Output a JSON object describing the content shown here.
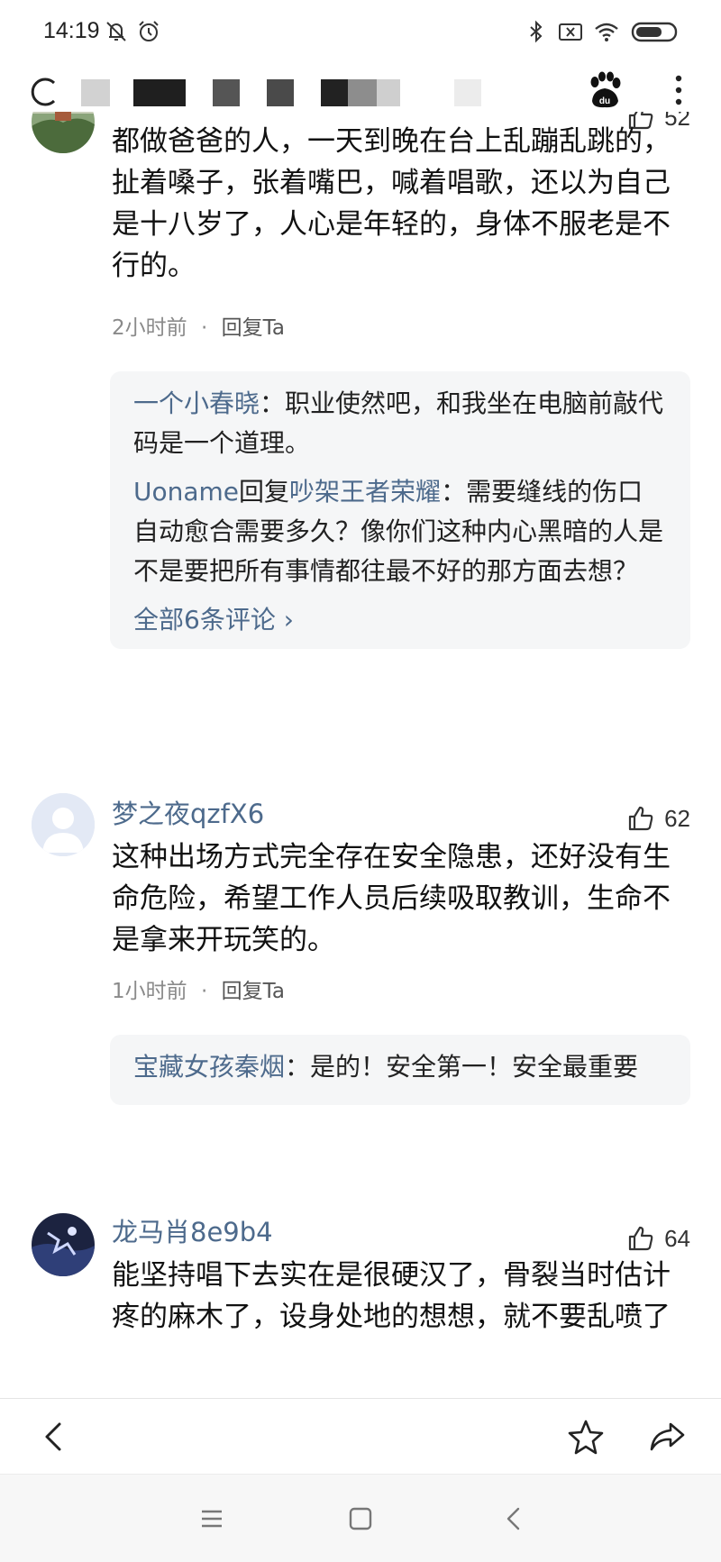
{
  "status_bar": {
    "time": "14:19",
    "icons": [
      "bell-off-icon",
      "alarm-icon",
      "bluetooth-icon",
      "sim-x-icon",
      "wifi-icon",
      "battery-icon"
    ]
  },
  "toolbar": {
    "icons": [
      "loading-spinner-icon",
      "baidu-paw-icon",
      "more-vertical-icon"
    ]
  },
  "comments": [
    {
      "author": "",
      "likes": "52",
      "text": "都做爸爸的人，一天到晚在台上乱蹦乱跳的，扯着嗓子，张着嘴巴，喊着唱歌，还以为自己是十八岁了，人心是年轻的，身体不服老是不行的。",
      "time": "2小时前",
      "separator": "·",
      "reply_label": "回复Ta",
      "replies": [
        {
          "name": "一个小春晓",
          "colon": "：",
          "text": "职业使然吧，和我坐在电脑前敲代码是一个道理。"
        },
        {
          "name": "Uoname",
          "connector": "回复",
          "target": "吵架王者荣耀",
          "colon": "：",
          "text": "需要缝线的伤口自动愈合需要多久？像你们这种内心黑暗的人是不是要把所有事情都往最不好的那方面去想？"
        }
      ],
      "view_all": "全部6条评论 ›"
    },
    {
      "author": "梦之夜qzfX6",
      "likes": "62",
      "text": "这种出场方式完全存在安全隐患，还好没有生命危险，希望工作人员后续吸取教训，生命不是拿来开玩笑的。",
      "time": "1小时前",
      "separator": "·",
      "reply_label": "回复Ta",
      "replies": [
        {
          "name": "宝藏女孩秦烟",
          "colon": "：",
          "text": "是的！安全第一！安全最重要"
        }
      ]
    },
    {
      "author": "龙马肖8e9b4",
      "likes": "64",
      "text": "能坚持唱下去实在是很硬汉了，骨裂当时估计疼的麻木了，设身处地的想想，就不要乱喷了"
    }
  ],
  "action_bar": {
    "icons": [
      "back-icon",
      "star-icon",
      "share-icon"
    ]
  },
  "nav_bar": {
    "icons": [
      "menu-icon",
      "home-square-icon",
      "back-triangle-icon"
    ]
  },
  "colors": {
    "link": "#4d6a8c",
    "reply_bg": "#f5f6f7",
    "meta": "#8a8a8a"
  }
}
